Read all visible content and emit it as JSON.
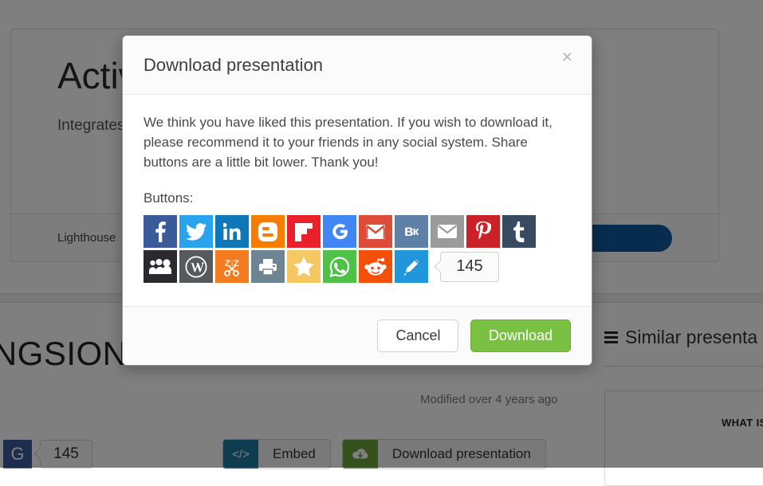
{
  "page": {
    "hero": {
      "title": "Activ",
      "description": "Integrates     data on demend.",
      "author": "Lighthouse",
      "cta_label": ""
    },
    "deck_title": "UNGSION",
    "modified": "Modified over 4 years ago",
    "gplus": {
      "icon": "google-plus-icon",
      "glyph": "G",
      "count": "145"
    },
    "bottom_buttons": [
      {
        "name": "embed",
        "icon": "code-icon",
        "glyph": "</>",
        "label": "Embed",
        "color": "#1b7a9e"
      },
      {
        "name": "download-presentation",
        "icon": "cloud-download-icon",
        "glyph": "☁",
        "label": "Download presentation",
        "color": "#6ba33a"
      }
    ],
    "similar": {
      "icon": "list-icon",
      "heading": "Similar presenta",
      "card_caption": "WHAT IS GRAM"
    }
  },
  "modal": {
    "title": "Download presentation",
    "close_label": "×",
    "body_text": "We think you have liked this presentation. If you wish to download it, please recommend it to your friends in any social system. Share buttons are a little bit lower. Thank you!",
    "buttons_label": "Buttons:",
    "share_counter": "145",
    "share_rows": [
      [
        {
          "name": "facebook",
          "title": "Facebook",
          "color": "#3b5a9a"
        },
        {
          "name": "twitter",
          "title": "Twitter",
          "color": "#2aa3ef"
        },
        {
          "name": "linkedin",
          "title": "LinkedIn",
          "color": "#0d77b7"
        },
        {
          "name": "blogger",
          "title": "Blogger",
          "color": "#f57d00"
        },
        {
          "name": "flipboard",
          "title": "Flipboard",
          "color": "#e8212a"
        },
        {
          "name": "google",
          "title": "Google",
          "color": "#4285f4"
        },
        {
          "name": "gmail",
          "title": "Gmail",
          "color": "#dd4b39"
        },
        {
          "name": "vk",
          "title": "VK",
          "color": "#5e7fa6"
        },
        {
          "name": "email",
          "title": "Email",
          "color": "#9b9b9b"
        },
        {
          "name": "pinterest",
          "title": "Pinterest",
          "color": "#c92228"
        },
        {
          "name": "tumblr",
          "title": "Tumblr",
          "color": "#374a5f"
        }
      ],
      [
        {
          "name": "myspace",
          "title": "MySpace",
          "color": "#29292e"
        },
        {
          "name": "wordpress",
          "title": "WordPress",
          "color": "#565a5c"
        },
        {
          "name": "clipboard",
          "title": "Clipboard",
          "color": "#f47b20"
        },
        {
          "name": "print",
          "title": "Print",
          "color": "#6d8492"
        },
        {
          "name": "favorites",
          "title": "Favorites",
          "color": "#f5c863"
        },
        {
          "name": "whatsapp",
          "title": "WhatsApp",
          "color": "#4dc247"
        },
        {
          "name": "reddit",
          "title": "Reddit",
          "color": "#f4500a"
        },
        {
          "name": "livejournal",
          "title": "LiveJournal",
          "color": "#2196db"
        }
      ]
    ],
    "cancel_label": "Cancel",
    "download_label": "Download"
  },
  "colors": {
    "accent_blue": "#11589c",
    "accent_green": "#7ac143",
    "overlay": "rgba(0,0,0,0.5)"
  }
}
